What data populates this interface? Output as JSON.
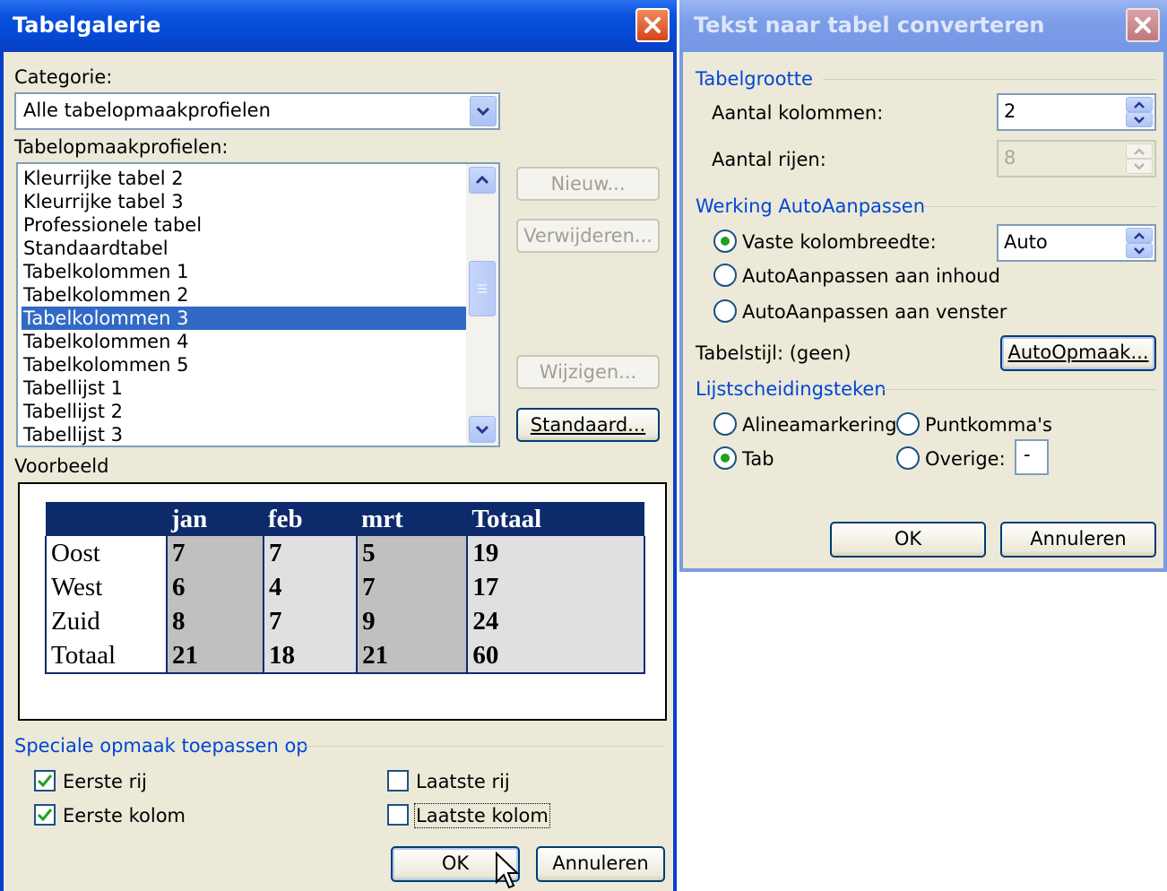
{
  "gallery": {
    "title": "Tabelgalerie",
    "category_label": "Categorie:",
    "category_value": "Alle tabelopmaakprofielen",
    "styles_label": "Tabelopmaakprofielen:",
    "styles": [
      "Kleurrijke tabel 2",
      "Kleurrijke tabel 3",
      "Professionele tabel",
      "Standaardtabel",
      "Tabelkolommen 1",
      "Tabelkolommen 2",
      "Tabelkolommen 3",
      "Tabelkolommen 4",
      "Tabelkolommen 5",
      "Tabellijst 1",
      "Tabellijst 2",
      "Tabellijst 3"
    ],
    "selected_style": "Tabelkolommen 3",
    "buttons": {
      "new": "Nieuw...",
      "delete": "Verwijderen...",
      "modify": "Wijzigen...",
      "default": "Standaard...",
      "ok": "OK",
      "cancel": "Annuleren"
    },
    "preview_label": "Voorbeeld",
    "preview": {
      "headers": [
        "",
        "jan",
        "feb",
        "mrt",
        "Totaal"
      ],
      "rows": [
        [
          "Oost",
          "7",
          "7",
          "5",
          "19"
        ],
        [
          "West",
          "6",
          "4",
          "7",
          "17"
        ],
        [
          "Zuid",
          "8",
          "7",
          "9",
          "24"
        ],
        [
          "Totaal",
          "21",
          "18",
          "21",
          "60"
        ]
      ]
    },
    "special_label": "Speciale opmaak toepassen op",
    "options": {
      "first_row": {
        "label": "Eerste rij",
        "checked": true
      },
      "first_col": {
        "label": "Eerste kolom",
        "checked": true
      },
      "last_row": {
        "label": "Laatste rij",
        "checked": false
      },
      "last_col": {
        "label": "Laatste kolom",
        "checked": false
      }
    }
  },
  "convert": {
    "title": "Tekst naar tabel converteren",
    "size_label": "Tabelgrootte",
    "columns_label": "Aantal kolommen:",
    "columns_value": "2",
    "rows_label": "Aantal rijen:",
    "rows_value": "8",
    "autofit_label": "Werking AutoAanpassen",
    "fixed_width_label": "Vaste kolombreedte:",
    "fixed_width_value": "Auto",
    "fit_content_label": "AutoAanpassen aan inhoud",
    "fit_window_label": "AutoAanpassen aan venster",
    "table_style_label": "Tabelstijl: (geen)",
    "autoformat_button": "AutoOpmaak...",
    "separator_label": "Lijstscheidingsteken",
    "sep_paragraph": "Alineamarkering",
    "sep_semicolon": "Puntkomma's",
    "sep_tab": "Tab",
    "sep_other": "Overige:",
    "sep_other_value": "-",
    "selected_autofit": "fixed",
    "selected_separator": "tab",
    "ok": "OK",
    "cancel": "Annuleren"
  },
  "colors": {
    "accent_blue": "#0046d5",
    "selection": "#316ac5",
    "preview_header": "#0d2b6b"
  }
}
